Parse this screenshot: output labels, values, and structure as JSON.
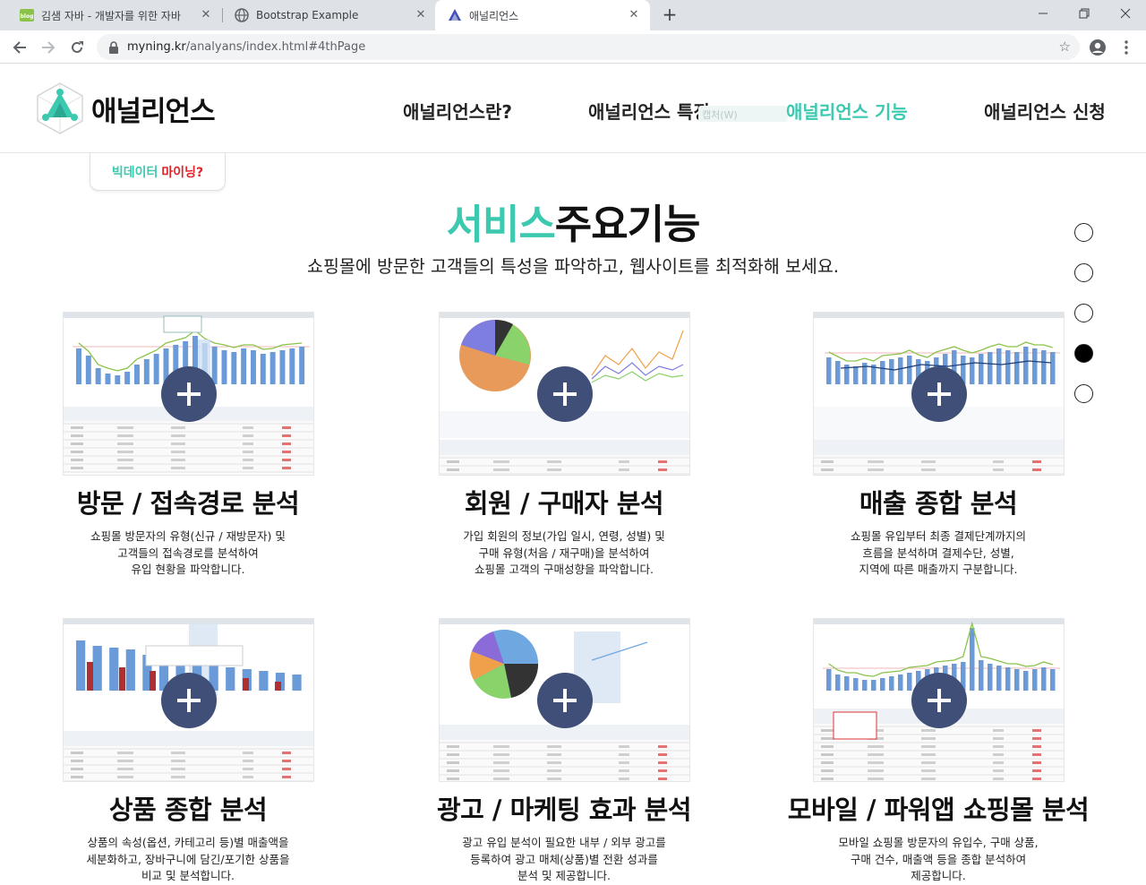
{
  "browser": {
    "tabs": [
      {
        "title": "김샘 자바 - 개발자를 위한 자바",
        "icon": "blog-icon"
      },
      {
        "title": "Bootstrap Example",
        "icon": "globe-icon"
      },
      {
        "title": "애널리언스",
        "icon": "analyans-logo-icon"
      }
    ],
    "active_tab": 2,
    "url_host": "myning.kr",
    "url_path": "/analyans/index.html#4thPage",
    "favicon_text": "blog"
  },
  "header": {
    "logo_text": "애널리언스",
    "nav": [
      {
        "label": "애널리언스란?"
      },
      {
        "label": "애널리언스 특징"
      },
      {
        "label": "애널리언스 기능",
        "active": true
      },
      {
        "label": "애널리언스 신청"
      }
    ],
    "ghost_tooltip": "캡처(W)",
    "sub_link_a": "빅데이터",
    "sub_link_b": "마이닝?"
  },
  "section": {
    "title_accent": "서비스",
    "title_rest": "주요기능",
    "subtitle": "쇼핑몰에 방문한 고객들의 특성을 파악하고, 웹사이트를 최적화해 보세요."
  },
  "page_dots": {
    "count": 5,
    "active_index": 3
  },
  "colors": {
    "accent": "#3cc9b0",
    "plus_button": "#3f4f77",
    "sub_link_red": "#e0242c"
  },
  "cards": [
    {
      "title": "방문 / 접속경로 분석",
      "desc": [
        "쇼핑몰 방문자의 유형(신규 / 재방문자) 및",
        "고객들의 접속경로를 분석하여",
        "유입 현황을 파악합니다."
      ],
      "thumb": "visits"
    },
    {
      "title": "회원 / 구매자 분석",
      "desc": [
        "가입 회원의 정보(가입 일시, 연령, 성별) 및",
        "구매 유형(처음 / 재구매)을 분석하여",
        "쇼핑몰 고객의 구매성향을 파악합니다."
      ],
      "thumb": "members"
    },
    {
      "title": "매출 종합 분석",
      "desc": [
        "쇼핑몰 유입부터 최종 결제단계까지의",
        "흐름을 분석하며 결제수단, 성별,",
        "지역에 따른 매출까지 구분합니다."
      ],
      "thumb": "sales"
    },
    {
      "title": "상품 종합 분석",
      "desc": [
        "상품의 속성(옵션, 카테고리 등)별 매출액을",
        "세분화하고, 장바구니에 담긴/포기한 상품을",
        "비교 및 분석합니다."
      ],
      "thumb": "products"
    },
    {
      "title": "광고 / 마케팅 효과 분석",
      "desc": [
        "광고 유입 분석이 필요한 내부 / 외부 광고를",
        "등록하여 광고 매체(상품)별 전환 성과를",
        "분석 및 제공합니다."
      ],
      "thumb": "ads"
    },
    {
      "title": "모바일 / 파워앱 쇼핑몰 분석",
      "desc": [
        "모바일 쇼핑몰 방문자의 유입수, 구매 상품,",
        "구매 건수, 매출액 등을 종합 분석하여",
        "제공합니다."
      ],
      "thumb": "mobile"
    }
  ]
}
